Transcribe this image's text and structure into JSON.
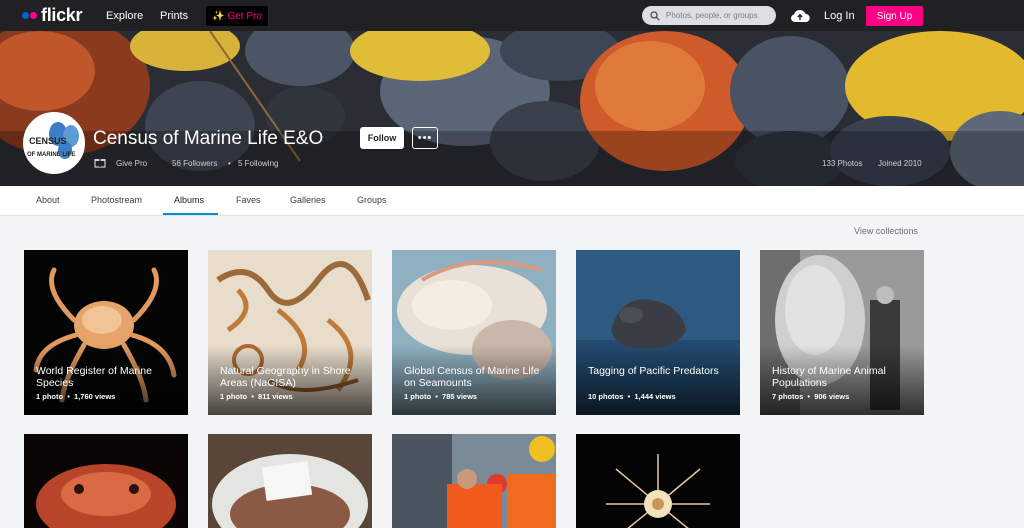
{
  "topbar": {
    "logo": "flickr",
    "nav": [
      "Explore",
      "Prints"
    ],
    "get_pro": "Get Pro",
    "search_placeholder": "Photos, people, or groups",
    "login": "Log In",
    "signup": "Sign Up"
  },
  "profile": {
    "name": "Census of Marine Life E&O",
    "follow": "Follow",
    "more": "•••",
    "give_pro": "Give Pro",
    "followers": "56 Followers",
    "following": "5 Following",
    "photos_count": "133 Photos",
    "joined": "Joined 2010",
    "avatar_text_1": "CENSUS",
    "avatar_text_2": "OF MARINE LIFE"
  },
  "tabs": [
    "About",
    "Photostream",
    "Albums",
    "Faves",
    "Galleries",
    "Groups"
  ],
  "active_tab": "Albums",
  "view_collections": "View collections",
  "albums": [
    {
      "title": "World Register of Marine Species",
      "photos": "1 photo",
      "views": "1,760 views"
    },
    {
      "title": "Natural Geography in Shore Areas (NaGISA)",
      "photos": "1 photo",
      "views": "811 views"
    },
    {
      "title": "Global Census of Marine Life on Seamounts",
      "photos": "1 photo",
      "views": "785 views"
    },
    {
      "title": "Tagging of Pacific Predators",
      "photos": "10 photos",
      "views": "1,444 views"
    },
    {
      "title": "History of Marine Animal Populations",
      "photos": "7 photos",
      "views": "906 views"
    }
  ],
  "icons": [
    "search-icon",
    "upload-cloud-icon",
    "gift-icon",
    "sparkle-icon"
  ],
  "colors": {
    "brand_blue": "#0063dc",
    "brand_pink": "#ff0084",
    "tab_underline": "#008ecf",
    "topbar": "#212124"
  }
}
